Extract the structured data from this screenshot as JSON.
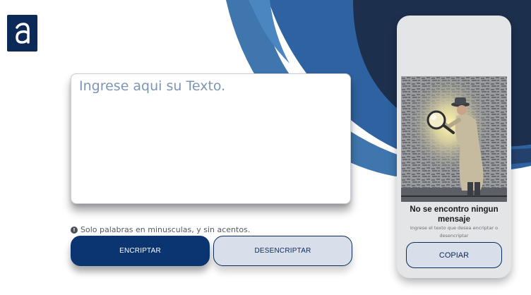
{
  "brand": {
    "logo_icon": "alura-a-logo-icon"
  },
  "editor": {
    "placeholder": "Ingrese aqui su Texto.",
    "value": ""
  },
  "hint": {
    "icon": "exclamation-circle-icon",
    "text": "Solo palabras en minusculas, y sin acentos."
  },
  "actions": {
    "encrypt_label": "ENCRIPTAR",
    "decrypt_label": "DESENCRIPTAR"
  },
  "result_panel": {
    "illustration": "detective-with-magnifying-glass-illustration",
    "title": "No se encontro ningun mensaje",
    "subtitle": "Ingrese el texto que desea encriptar o desencriptar",
    "copy_label": "COPIAR"
  },
  "colors": {
    "primary": "#0b3570",
    "dark_navy": "#0b2a57",
    "accent_blue": "#3f76ad",
    "light_button": "#d8dfea",
    "panel_bg": "#e4e5e7"
  }
}
